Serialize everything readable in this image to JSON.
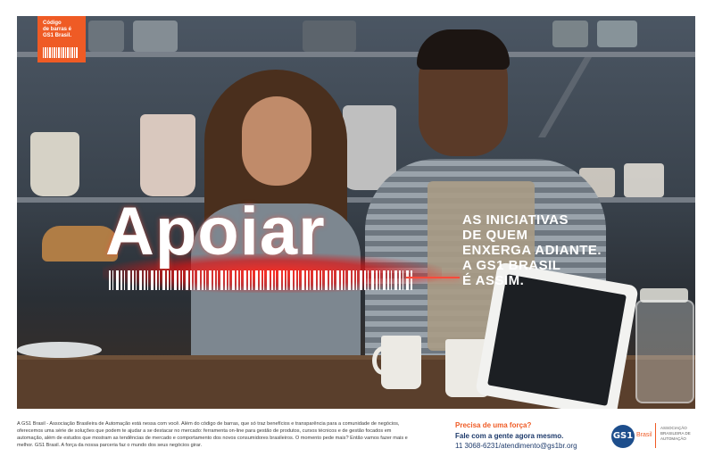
{
  "badge": {
    "line1": "Código",
    "line2": "de barras é",
    "line3": "GS1 Brasil."
  },
  "headline": "Apoiar",
  "tagline": [
    "AS INICIATIVAS",
    "DE QUEM",
    "ENXERGA ADIANTE.",
    "A GS1 BRASIL",
    "É ASSIM."
  ],
  "footer": {
    "body": "A GS1 Brasil - Associação Brasileira de Automação está nessa com você. Além do código de barras, que só traz benefícios e transparência para a comunidade de negócios, oferecemos uma série de soluções que podem te ajudar a se destacar no mercado: ferramenta on-line para gestão de produtos, cursos técnicos e de gestão focados em automação, além de estudos que mostram as tendências de mercado e comportamento dos novos consumidores brasileiros. O momento pede mais? Então vamos fazer mais e melhor. GS1 Brasil. A força da nossa parceria faz o mundo dos seus negócios girar.",
    "cta_question": "Precisa de uma força?",
    "cta_line": "Fale com a gente agora mesmo.",
    "contact": "11 3068-6231/atendimento@gs1br.org"
  },
  "logo": {
    "mark": "GS1",
    "sub": "Brasil",
    "description": "ASSOCIAÇÃO BRASILEIRA DE AUTOMAÇÃO"
  },
  "colors": {
    "brand_orange": "#ef5b25",
    "brand_blue": "#1d3a6b"
  }
}
